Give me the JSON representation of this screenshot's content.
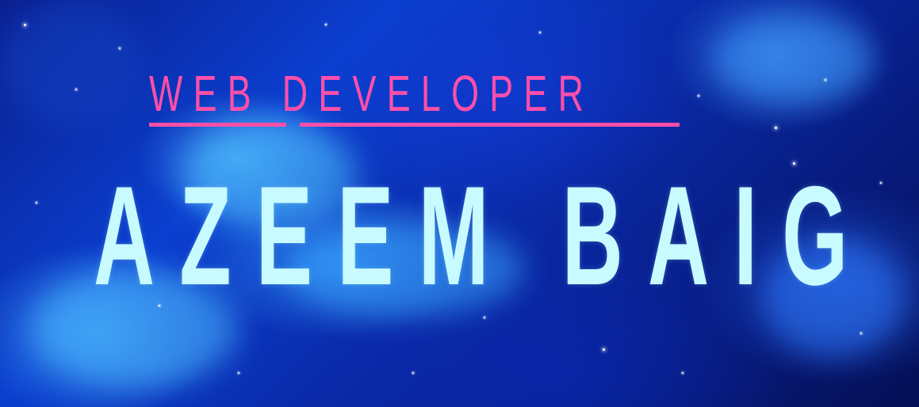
{
  "subtitle": "WEB DEVELOPER",
  "title": "AZEEM BAIG",
  "colors": {
    "subtitle": "#ff4fa8",
    "title": "#c8fbff",
    "background": "#0b3fd0"
  },
  "background_icon": "nebula-starfield"
}
